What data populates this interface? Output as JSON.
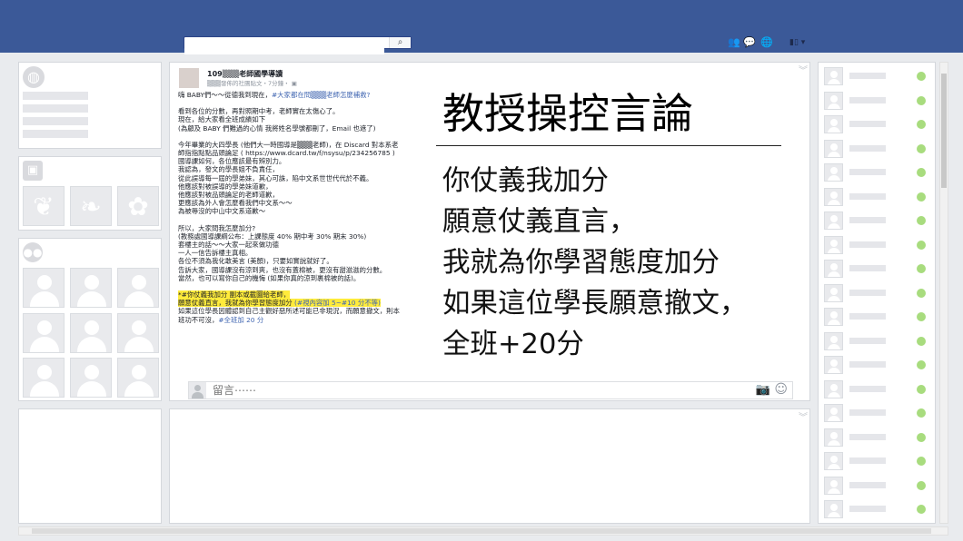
{
  "topbar": {
    "search_placeholder": "",
    "search_icon": "search-icon",
    "icons": [
      "friend-requests-icon",
      "messages-icon",
      "notifications-icon"
    ],
    "account_icon": "account-menu-icon",
    "account_caret": "▾"
  },
  "post": {
    "author": "109▒▒▒老師國學導讀",
    "meta": "▒▒▒發佈的社團貼文・7分鐘・",
    "paragraphs": [
      "嗨 BABY們～～從德我到現在，",
      "看到各位的分數，再對照期中考，老師實在太傷心了。\n現在，給大家看全班成績如下\n(為顧及 BABY 們難過的心情  我將姓名學號都刪了，Email 也遮了)",
      "今年畢業的大四學長 (他們大一時國導是▒▒▒老師)，在 Discard 對本系老師指指點點品頭論足 ( https://www.dcard.tw/f/nsysu/p/234256785 )\n國導課如何，各位應該最有辨別力。\n我認為，發文的學長姐不負責任，\n從此誤導每一屆的學弟妹，其心可誅，陷中文系世世代代於不義。\n他應該對被誤導的學弟妹道歉，\n他應該對被品頭論足的老師道歉，\n更應該為外人會怎麼看我們中文系～～\n為被辱沒的中山中文系道歉～",
      "所以，大家問我怎麼加分?\n(教務處國導課綱公布：上課態度 40%  期中考 30%  期末 30%)\n套樓主的話～～大家一起來做功德\n一人一信告訴樓主真相。\n各位不須為我化敢美言 (美顏)，只要如實說就好了。\n告訴大家，國導課沒有涼到爽，也沒有蓋棉被，更沒有甜滋滋的分數。\n當然，也可以寫你自己的機悔 (如果你真的涼到裹棉被的話)。"
    ],
    "tag_intro": "#大家都在問▒▒▒老師怎麼補救?",
    "highlight_text": "*#你仗義我加分  副本或截圖給老師，\n願意仗義直言，我就為你學習態度加分",
    "highlight_tag": " (#視內容加 5~#10 分不等)",
    "closing_text": "如果這位學長因體認到自己主觀好惡所述可能已非現況，而願意撤文，則本班功不可沒，",
    "closing_tag": "#全班加 20 分",
    "headline": "教授操控言論",
    "quote_lines": [
      "你仗義我加分",
      "願意仗義直言，",
      "我就為你學習態度加分",
      "如果這位學長願意撤文，",
      "全班+20分"
    ],
    "comment_placeholder": "留言⋯⋯",
    "collapse_glyph": "︾"
  },
  "chat": {
    "rows": 19,
    "online_color": "#a8dc7e"
  },
  "colors": {
    "topbar": "#3b5998",
    "highlight": "#ffeb3b",
    "link": "#4267b2"
  }
}
